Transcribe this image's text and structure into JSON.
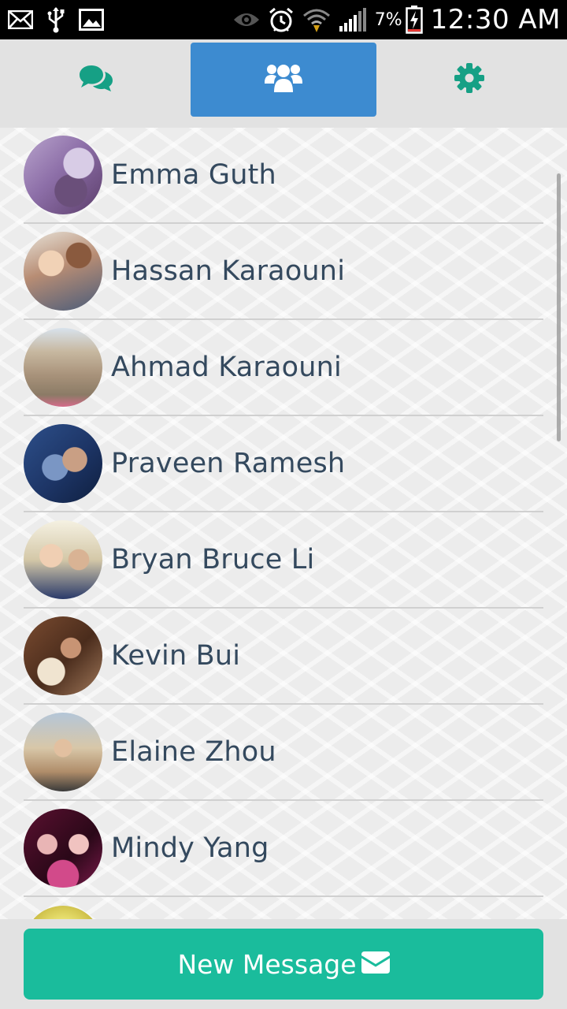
{
  "status_bar": {
    "battery_percent": "7%",
    "time": "12:30 AM",
    "left_icons": [
      "mail-icon",
      "usb-icon",
      "image-icon"
    ],
    "right_icons": [
      "eye-icon",
      "alarm-icon",
      "wifi-icon",
      "signal-icon",
      "battery-charging-icon"
    ]
  },
  "tabs": [
    {
      "name": "chat",
      "icon": "chat-bubbles-icon",
      "active": false
    },
    {
      "name": "friends",
      "icon": "users-icon",
      "active": true
    },
    {
      "name": "settings",
      "icon": "gear-icon",
      "active": false
    }
  ],
  "colors": {
    "accent_blue": "#3d8bd0",
    "accent_green": "#1abc9c",
    "text_dark": "#34495e"
  },
  "contacts": [
    {
      "name": "Emma Guth"
    },
    {
      "name": "Hassan Karaouni"
    },
    {
      "name": "Ahmad Karaouni"
    },
    {
      "name": "Praveen Ramesh"
    },
    {
      "name": "Bryan Bruce Li"
    },
    {
      "name": "Kevin Bui"
    },
    {
      "name": "Elaine Zhou"
    },
    {
      "name": "Mindy Yang"
    }
  ],
  "bottom": {
    "new_message_label": "New Message"
  }
}
